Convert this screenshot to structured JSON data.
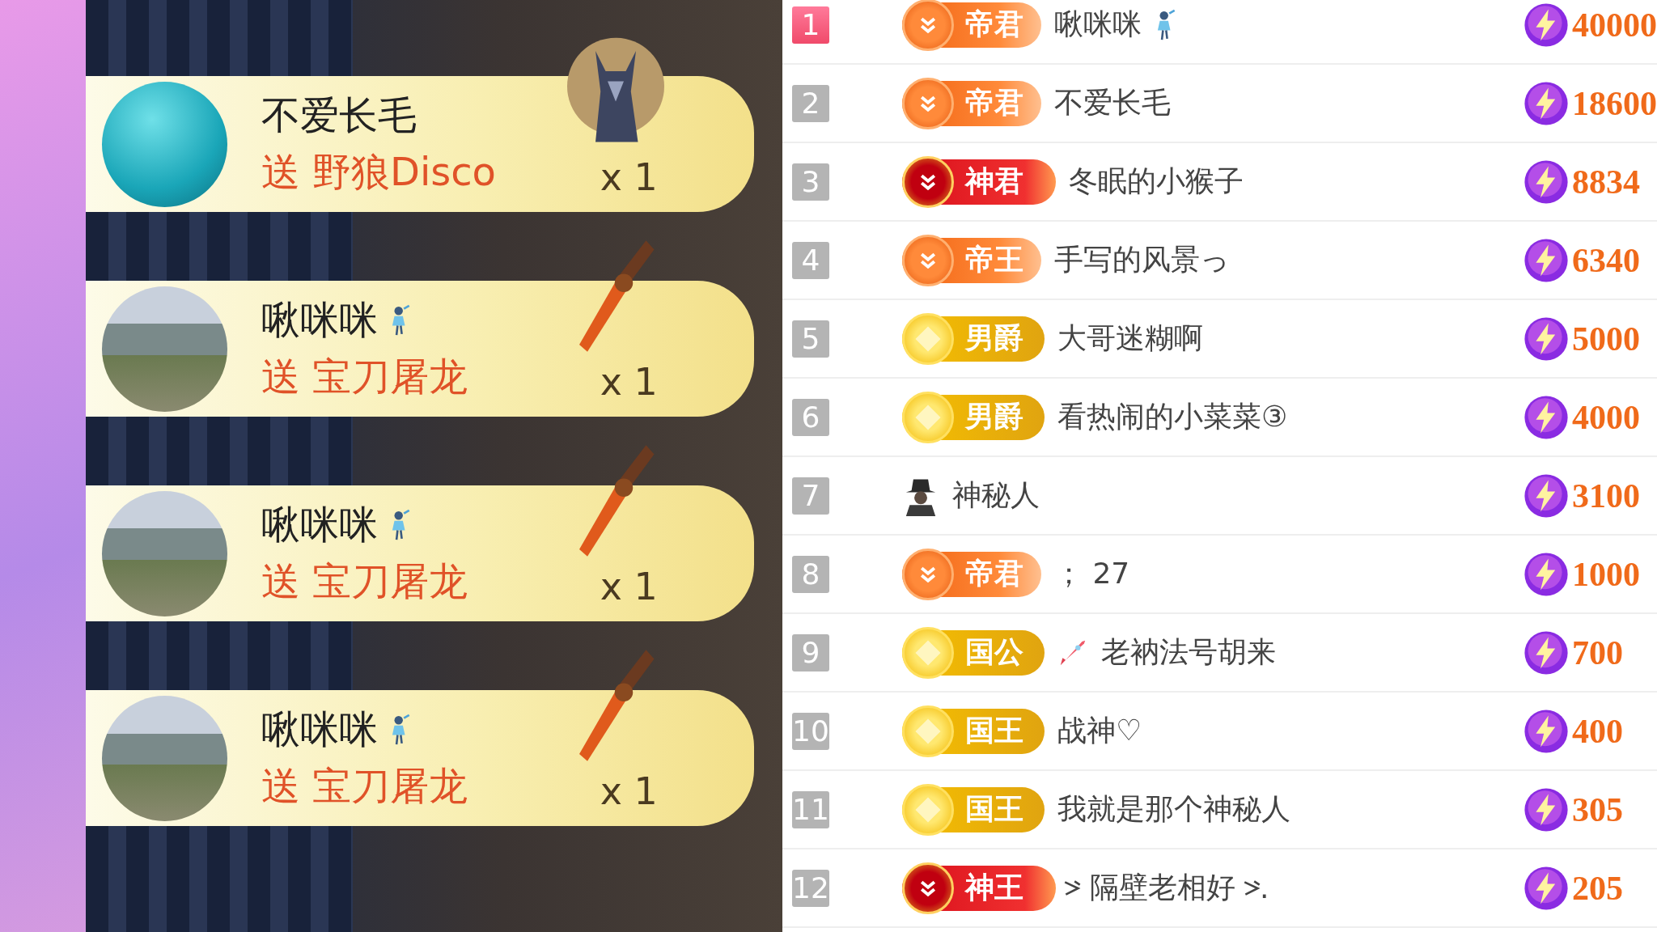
{
  "gift_feed": [
    {
      "kind": "wolf",
      "sender": "不爱长毛",
      "fairy_icon": false,
      "gift": "送 野狼Disco",
      "count": "x 1"
    },
    {
      "kind": "sword",
      "sender": "啾咪咪",
      "fairy_icon": true,
      "gift": "送 宝刀屠龙",
      "count": "x 1"
    },
    {
      "kind": "sword",
      "sender": "啾咪咪",
      "fairy_icon": true,
      "gift": "送 宝刀屠龙",
      "count": "x 1"
    },
    {
      "kind": "sword",
      "sender": "啾咪咪",
      "fairy_icon": true,
      "gift": "送 宝刀屠龙",
      "count": "x 1"
    }
  ],
  "ranking": [
    {
      "rank": "1",
      "top": true,
      "kind": "orange",
      "badge": "帝君",
      "rocket_icon": false,
      "deco_marks": false,
      "name": "啾咪咪",
      "fairy_icon": true,
      "score": "40000"
    },
    {
      "rank": "2",
      "top": false,
      "kind": "orange",
      "badge": "帝君",
      "rocket_icon": false,
      "deco_marks": false,
      "name": "不爱长毛",
      "fairy_icon": false,
      "score": "18600"
    },
    {
      "rank": "3",
      "top": false,
      "kind": "red",
      "badge": "神君",
      "rocket_icon": false,
      "deco_marks": false,
      "name": "冬眠的小猴子",
      "fairy_icon": false,
      "score": "8834"
    },
    {
      "rank": "4",
      "top": false,
      "kind": "orange",
      "badge": "帝王",
      "rocket_icon": false,
      "deco_marks": false,
      "name": "手写的风景っ",
      "fairy_icon": false,
      "score": "6340"
    },
    {
      "rank": "5",
      "top": false,
      "kind": "gold",
      "badge": "男爵",
      "rocket_icon": false,
      "deco_marks": false,
      "name": "大哥迷糊啊",
      "fairy_icon": false,
      "score": "5000"
    },
    {
      "rank": "6",
      "top": false,
      "kind": "gold",
      "badge": "男爵",
      "rocket_icon": false,
      "deco_marks": false,
      "name": "看热闹的小菜菜③",
      "fairy_icon": false,
      "score": "4000"
    },
    {
      "rank": "7",
      "top": false,
      "kind": "mystery",
      "rocket_icon": false,
      "deco_marks": false,
      "name": "神秘人",
      "fairy_icon": false,
      "score": "3100"
    },
    {
      "rank": "8",
      "top": false,
      "kind": "orange",
      "badge": "帝君",
      "rocket_icon": false,
      "deco_marks": false,
      "name": "； 27",
      "fairy_icon": false,
      "score": "1000"
    },
    {
      "rank": "9",
      "top": false,
      "kind": "gold",
      "badge": "国公",
      "rocket_icon": true,
      "deco_marks": false,
      "name": "老衲法号胡来",
      "fairy_icon": false,
      "score": "700"
    },
    {
      "rank": "10",
      "top": false,
      "kind": "gold",
      "badge": "国王",
      "rocket_icon": false,
      "deco_marks": false,
      "name": "战神♡",
      "fairy_icon": false,
      "score": "400"
    },
    {
      "rank": "11",
      "top": false,
      "kind": "gold",
      "badge": "国王",
      "rocket_icon": false,
      "deco_marks": false,
      "name": "我就是那个神秘人",
      "fairy_icon": false,
      "score": "305"
    },
    {
      "rank": "12",
      "top": false,
      "kind": "red",
      "badge": "神王",
      "rocket_icon": false,
      "deco_marks": true,
      "name": "隔壁老相好",
      "name_suffix": ".",
      "fairy_icon": false,
      "score": "205"
    }
  ]
}
